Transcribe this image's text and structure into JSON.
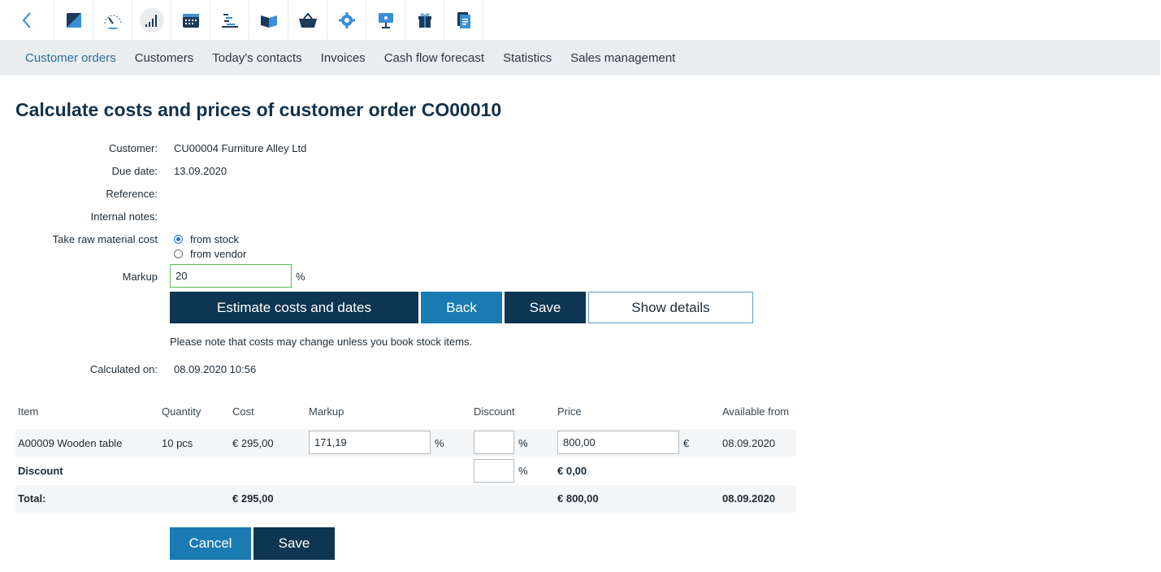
{
  "nav": {
    "tabs": [
      "Customer orders",
      "Customers",
      "Today's contacts",
      "Invoices",
      "Cash flow forecast",
      "Statistics",
      "Sales management"
    ]
  },
  "page": {
    "title": "Calculate costs and prices of customer order CO00010"
  },
  "form": {
    "customer_label": "Customer:",
    "customer_value": "CU00004 Furniture Alley Ltd",
    "due_label": "Due date:",
    "due_value": "13.09.2020",
    "reference_label": "Reference:",
    "notes_label": "Internal notes:",
    "raw_cost_label": "Take raw material cost",
    "radio_stock": "from stock",
    "radio_vendor": "from vendor",
    "markup_label": "Markup",
    "markup_value": "20",
    "percent": "%",
    "calculated_label": "Calculated on:",
    "calculated_value": "08.09.2020 10:56"
  },
  "buttons": {
    "estimate": "Estimate costs and dates",
    "back": "Back",
    "save": "Save",
    "show_details": "Show details",
    "cancel": "Cancel",
    "save_bottom": "Save"
  },
  "note": "Please note that costs may change unless you book stock items.",
  "table": {
    "headers": [
      "Item",
      "Quantity",
      "Cost",
      "Markup",
      "Discount",
      "Price",
      "Available from"
    ],
    "row": {
      "item": "A00009 Wooden table",
      "quantity": "10 pcs",
      "cost": "€ 295,00",
      "markup": "171,19",
      "markup_unit": "%",
      "discount": "",
      "discount_unit": "%",
      "price": "800,00",
      "price_unit": "€",
      "available": "08.09.2020"
    },
    "discount_row": {
      "label": "Discount",
      "discount": "",
      "unit": "%",
      "price": "€ 0,00"
    },
    "total_row": {
      "label": "Total:",
      "cost": "€ 295,00",
      "price": "€ 800,00",
      "available": "08.09.2020"
    }
  },
  "icons": [
    "back-chevron-icon",
    "notes-icon",
    "speedometer-icon",
    "bar-chart-icon",
    "calendar-icon",
    "gantt-icon",
    "book-icon",
    "basket-icon",
    "gear-icon",
    "presentation-icon",
    "gift-icon",
    "document-icon"
  ],
  "colors": {
    "dark": "#0e3552",
    "blue": "#1a7bb3",
    "nav_bg": "#eaedf0",
    "active_tab": "#2a6f92"
  }
}
